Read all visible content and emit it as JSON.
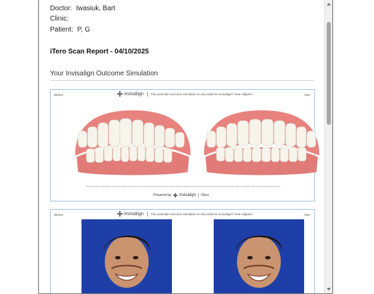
{
  "patient": {
    "doctor_label": "Doctor:",
    "doctor_value": "Iwasiuk, Bart",
    "clinic_label": "Clinic:",
    "clinic_value": "",
    "patient_label": "Patient:",
    "patient_value": "P, G"
  },
  "report": {
    "title": "iTero Scan Report - 04/10/2025",
    "section_title": "Your Invisalign Outcome Simulation"
  },
  "simulation_card": {
    "before_label": "Before",
    "after_label": "After",
    "brand": "invisalign",
    "note": "This potential outcome simulation is only valid for Invisalign® clear aligners",
    "disclaimer": "This simulation is intended to represent one potential outcome of Invisalign treatment and actual results may vary. Individual results will vary depending on the clinical case and patient compliance with the prescribed treatment plan.",
    "powered_by": "Powered by",
    "footer_brand": "invisalign",
    "footer_itero": "iTero"
  },
  "photo_card": {
    "before_label": "Before",
    "after_label": "After",
    "brand": "invisalign",
    "note": "This potential outcome simulation is only valid for Invisalign® clear aligners"
  },
  "icons": {
    "brand_logo": "invisalign-star-icon",
    "scroll_up": "chevron-up-icon",
    "scroll_down": "chevron-down-icon"
  },
  "colors": {
    "card_border": "#9fc2df",
    "photo_background": "#1f3fa8",
    "gum": "#e8827e",
    "tooth": "#f7f4ec"
  }
}
